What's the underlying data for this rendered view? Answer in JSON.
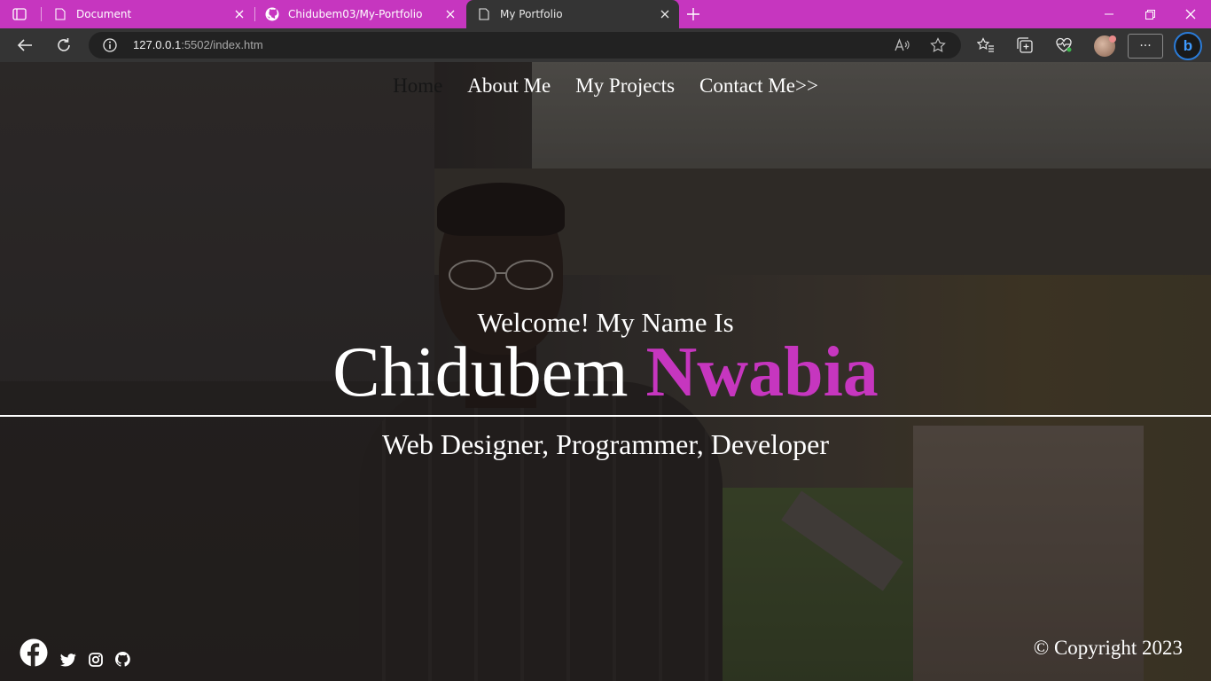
{
  "browser": {
    "tabs": [
      {
        "title": "Document",
        "icon": "document-icon",
        "active": false
      },
      {
        "title": "Chidubem03/My-Portfolio",
        "icon": "github-icon",
        "active": false
      },
      {
        "title": "My Portfolio",
        "icon": "document-icon",
        "active": true
      }
    ],
    "address": {
      "host": "127.0.0.1",
      "path": ":5502/index.htm"
    },
    "more_label": "···",
    "bing_label": "b"
  },
  "page": {
    "nav": {
      "home": "Home",
      "about": "About Me",
      "projects": "My Projects",
      "contact": "Contact Me>>"
    },
    "hero": {
      "welcome": "Welcome! My Name Is",
      "first_name": "Chidubem",
      "last_name": "Nwabia",
      "roles": "Web Designer, Programmer, Developer"
    },
    "footer": {
      "copyright": "© Copyright 2023",
      "social": [
        "facebook-icon",
        "twitter-icon",
        "instagram-icon",
        "github-icon"
      ]
    }
  },
  "colors": {
    "accent": "#c636bf",
    "toolbar": "#343434",
    "text": "#ffffff"
  }
}
